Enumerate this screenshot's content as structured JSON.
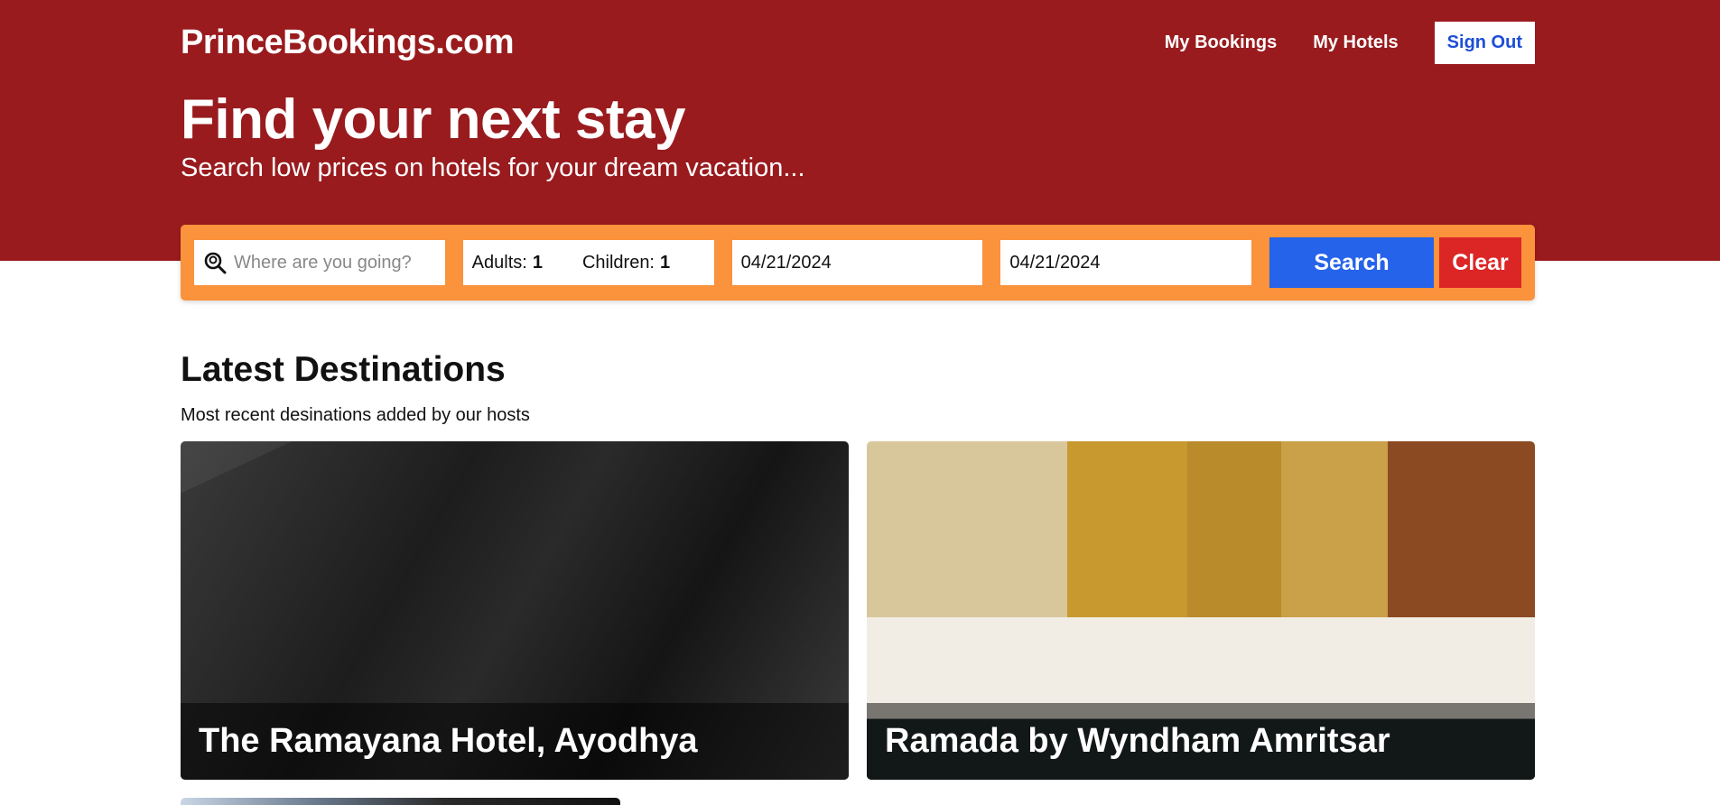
{
  "header": {
    "logo": "PrinceBookings.com",
    "nav": {
      "my_bookings": "My Bookings",
      "my_hotels": "My Hotels",
      "sign_out": "Sign Out"
    }
  },
  "hero": {
    "title": "Find your next stay",
    "subtitle": "Search low prices on hotels for your dream vacation..."
  },
  "search": {
    "destination_placeholder": "Where are you going?",
    "adults_label": "Adults:",
    "adults_value": "1",
    "children_label": "Children:",
    "children_value": "1",
    "check_in": "04/21/2024",
    "check_out": "04/21/2024",
    "search_label": "Search",
    "clear_label": "Clear"
  },
  "latest": {
    "title": "Latest Destinations",
    "subtitle": "Most recent desinations added by our hosts",
    "cards": [
      {
        "name": "The Ramayana Hotel, Ayodhya"
      },
      {
        "name": "Ramada by Wyndham Amritsar"
      }
    ]
  },
  "colors": {
    "hero_bg": "#991b1e",
    "search_bar": "#fb923c",
    "search_button": "#2563eb",
    "clear_button": "#dc2626"
  },
  "icons": {
    "search_field": "search-location-icon"
  }
}
